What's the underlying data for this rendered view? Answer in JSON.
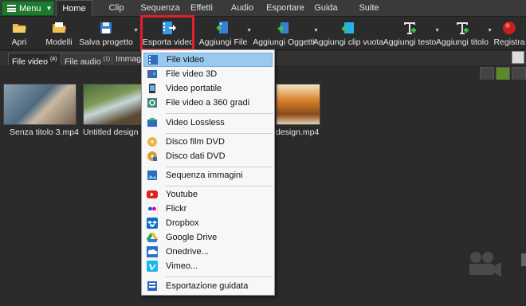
{
  "tabbar": {
    "menu_label": "Menu",
    "tabs": [
      {
        "label": "Home",
        "active": true
      },
      {
        "label": "Clip"
      },
      {
        "label": "Sequenza"
      },
      {
        "label": "Effetti"
      },
      {
        "label": "Audio"
      },
      {
        "label": "Esportare"
      },
      {
        "label": "Guida"
      },
      {
        "label": "Suite"
      }
    ]
  },
  "toolbar": {
    "items": [
      {
        "label": "Apri",
        "icon": "folder-open-icon"
      },
      {
        "label": "Modelli",
        "icon": "templates-icon"
      },
      {
        "label": "Salva progetto",
        "icon": "save-icon"
      },
      {
        "label": "Esporta video",
        "icon": "export-video-icon"
      },
      {
        "label": "Aggiungi File",
        "icon": "add-file-icon"
      },
      {
        "label": "Aggiungi Oggetti",
        "icon": "add-objects-icon"
      },
      {
        "label": "Aggiungi clip vuota",
        "icon": "blank-clip-icon"
      },
      {
        "label": "Aggiungi testo",
        "icon": "add-text-icon"
      },
      {
        "label": "Aggiungi titolo",
        "icon": "add-title-icon"
      },
      {
        "label": "Registra",
        "icon": "record-icon"
      }
    ]
  },
  "subtabs": [
    {
      "label": "File video",
      "count": "(4)",
      "active": true
    },
    {
      "label": "File audio",
      "count": "(1)"
    },
    {
      "label": "Immagi"
    }
  ],
  "media": {
    "items": [
      {
        "caption": "Senza titolo 3.mp4"
      },
      {
        "caption": "Untitled design (1)"
      },
      {
        "caption": "design.mp4"
      }
    ]
  },
  "dropdown": {
    "items": [
      {
        "label": "File video",
        "icon": "film-icon",
        "selected": true
      },
      {
        "label": "File video 3D",
        "icon": "film-3d-icon"
      },
      {
        "label": "Video portatile",
        "icon": "portable-device-icon"
      },
      {
        "label": "File video a 360 gradi",
        "icon": "video-360-icon"
      },
      {
        "label": "Video Lossless",
        "icon": "lossless-icon"
      },
      {
        "label": "Disco film DVD",
        "icon": "dvd-movie-icon"
      },
      {
        "label": "Disco dati DVD",
        "icon": "dvd-data-icon"
      },
      {
        "label": "Sequenza immagini",
        "icon": "image-sequence-icon"
      },
      {
        "label": "Youtube",
        "icon": "youtube-icon"
      },
      {
        "label": "Flickr",
        "icon": "flickr-icon"
      },
      {
        "label": "Dropbox",
        "icon": "dropbox-icon"
      },
      {
        "label": "Google Drive",
        "icon": "google-drive-icon"
      },
      {
        "label": "Onedrive...",
        "icon": "onedrive-icon"
      },
      {
        "label": "Vimeo...",
        "icon": "vimeo-icon"
      },
      {
        "label": "Esportazione guidata",
        "icon": "wizard-icon"
      }
    ]
  },
  "colors": {
    "accent_green": "#1f7a2f",
    "highlight_red": "#e0202a",
    "selection_blue": "#99c9ef"
  }
}
